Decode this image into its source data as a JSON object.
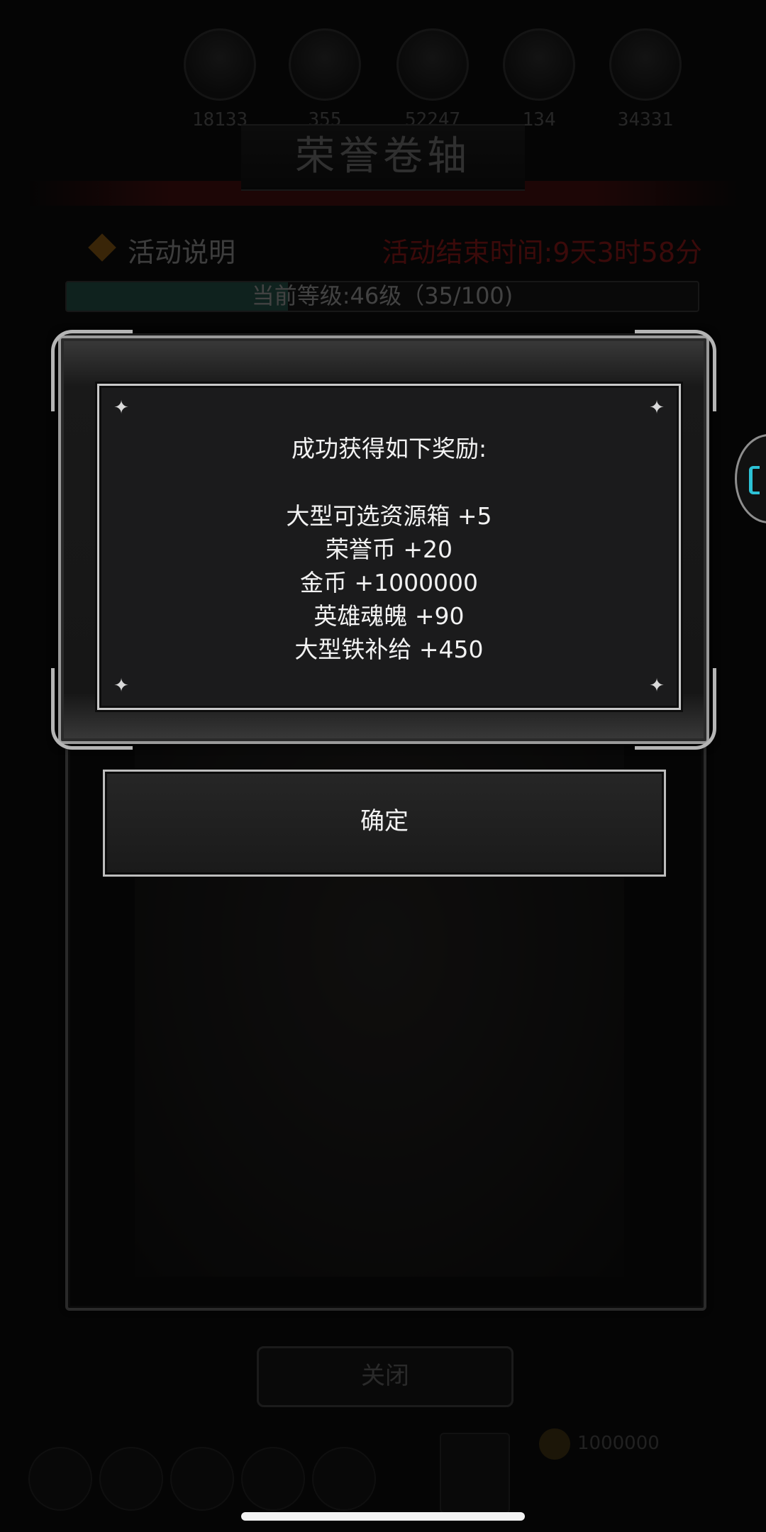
{
  "background": {
    "resources": [
      "18133",
      "355",
      "52247",
      "134",
      "34331"
    ],
    "event_title": "荣誉卷轴",
    "activity_label": "活动说明",
    "end_time_text": "活动结束时间:9天3时58分",
    "level_text": "当前等级:46级（35/100)",
    "level_progress": 0.35,
    "close_label": "关闭",
    "coin_text": "1000000"
  },
  "popup": {
    "title": "成功获得如下奖励:",
    "rewards": [
      "大型可选资源箱 +5",
      "荣誉币 +20",
      "金币 +1000000",
      "英雄魂魄 +90",
      "大型铁补给 +450"
    ],
    "sparkle_glyph": "✦"
  },
  "confirm_label": "确定",
  "colors": {
    "timer": "#c81a1a",
    "progress": "#2c6e5e",
    "accent": "#2dc2d6",
    "diamond": "#c07a10"
  }
}
